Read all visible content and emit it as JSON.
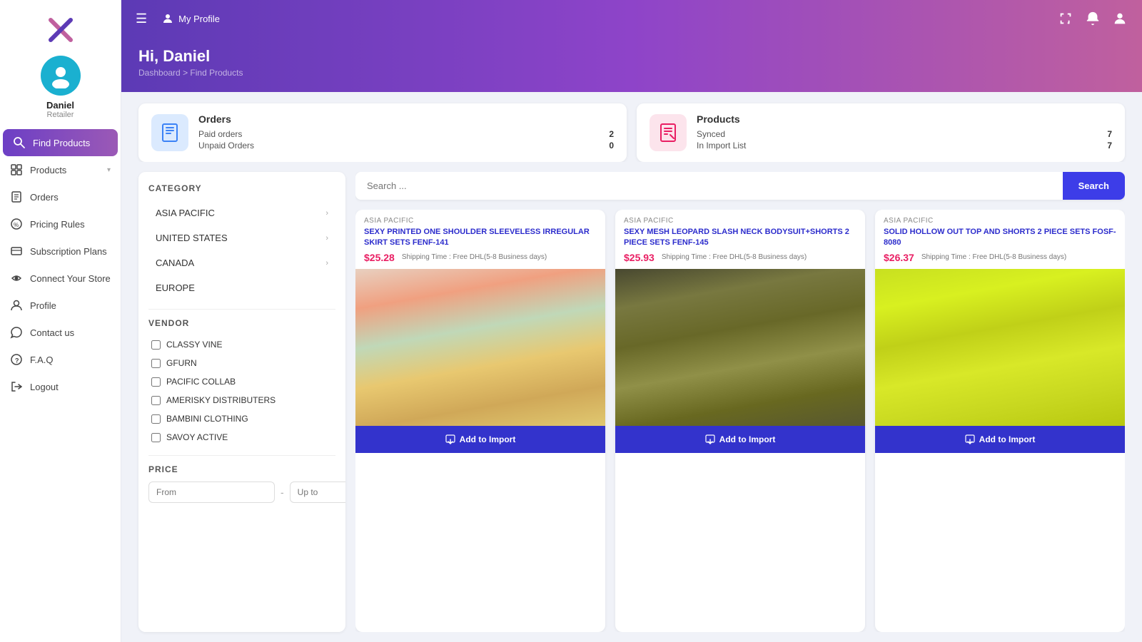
{
  "app": {
    "logo_text": "X",
    "user_name": "Daniel",
    "user_role": "Retailer"
  },
  "topbar": {
    "menu_icon": "☰",
    "profile_label": "My Profile"
  },
  "header": {
    "greeting": "Hi, Daniel",
    "breadcrumb_home": "Dashboard",
    "breadcrumb_sep": " > ",
    "breadcrumb_current": "Find Products"
  },
  "stats": {
    "orders": {
      "title": "Orders",
      "icon": "orders-icon",
      "paid_label": "Paid orders",
      "paid_value": "2",
      "unpaid_label": "Unpaid Orders",
      "unpaid_value": "0"
    },
    "products": {
      "title": "Products",
      "icon": "products-icon",
      "synced_label": "Synced",
      "synced_value": "7",
      "import_label": "In Import List",
      "import_value": "7"
    }
  },
  "sidebar_nav": {
    "items": [
      {
        "id": "find-products",
        "label": "Find Products",
        "active": true
      },
      {
        "id": "products",
        "label": "Products",
        "has_chevron": true
      },
      {
        "id": "orders",
        "label": "Orders"
      },
      {
        "id": "pricing-rules",
        "label": "Pricing Rules"
      },
      {
        "id": "subscription-plans",
        "label": "Subscription Plans"
      },
      {
        "id": "connect-store",
        "label": "Connect Your Store"
      },
      {
        "id": "profile",
        "label": "Profile"
      },
      {
        "id": "contact-us",
        "label": "Contact us"
      },
      {
        "id": "faq",
        "label": "F.A.Q"
      },
      {
        "id": "logout",
        "label": "Logout"
      }
    ]
  },
  "filter": {
    "category_title": "CATEGORY",
    "categories": [
      {
        "label": "ASIA PACIFIC",
        "has_arrow": true
      },
      {
        "label": "UNITED STATES",
        "has_arrow": true
      },
      {
        "label": "CANADA",
        "has_arrow": true
      },
      {
        "label": "EUROPE",
        "has_arrow": false
      }
    ],
    "vendor_title": "VENDOR",
    "vendors": [
      {
        "label": "CLASSY VINE",
        "checked": false
      },
      {
        "label": "GFURN",
        "checked": false
      },
      {
        "label": "PACIFIC COLLAB",
        "checked": false
      },
      {
        "label": "AMERISKY DISTRIBUTERS",
        "checked": false
      },
      {
        "label": "BAMBINI CLOTHING",
        "checked": false
      },
      {
        "label": "SAVOY ACTIVE",
        "checked": false
      }
    ],
    "price_title": "PRICE",
    "price_from_placeholder": "From",
    "price_to_placeholder": "Up to"
  },
  "search": {
    "placeholder": "Search ...",
    "button_label": "Search"
  },
  "products": [
    {
      "region": "ASIA PACIFIC",
      "name": "SEXY PRINTED ONE SHOULDER SLEEVELESS IRREGULAR SKIRT SETS FENF-141",
      "price": "$25.28",
      "shipping": "Shipping Time : Free DHL(5-8 Business days)",
      "img_color": "#c8e0d8",
      "add_label": "Add to Import"
    },
    {
      "region": "ASIA PACIFIC",
      "name": "SEXY MESH LEOPARD SLASH NECK BODYSUIT+SHORTS 2 PIECE SETS FENF-145",
      "price": "$25.93",
      "shipping": "Shipping Time : Free DHL(5-8 Business days)",
      "img_color": "#d8c8e0",
      "add_label": "Add to Import"
    },
    {
      "region": "ASIA PACIFIC",
      "name": "SOLID HOLLOW OUT TOP AND SHORTS 2 PIECE SETS FOSF-8080",
      "price": "$26.37",
      "shipping": "Shipping Time : Free DHL(5-8 Business days)",
      "img_color": "#e0d8c8",
      "add_label": "Add to Import"
    }
  ],
  "colors": {
    "active_nav": "#7b3fc4",
    "price_color": "#e91e63",
    "button_color": "#3333cc",
    "gradient_start": "#5c3ab5",
    "gradient_end": "#c0609e"
  }
}
